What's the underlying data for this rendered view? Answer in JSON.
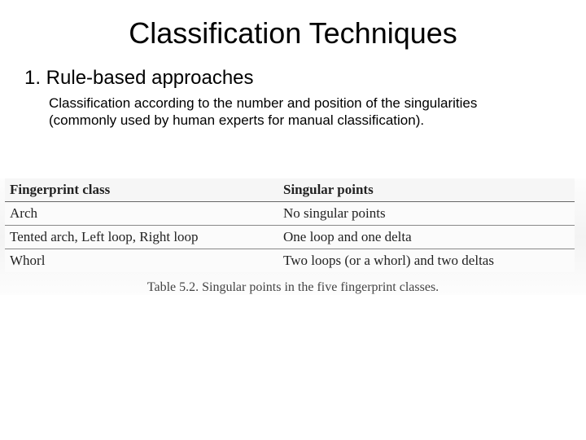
{
  "title": "Classification Techniques",
  "subheading": "1. Rule-based approaches",
  "body": "Classification according to the number and position of the singularities (commonly used by human experts for manual classification).",
  "table": {
    "headers": [
      "Fingerprint class",
      "Singular points"
    ],
    "rows": [
      [
        "Arch",
        "No singular points"
      ],
      [
        "Tented arch, Left loop, Right loop",
        "One loop and one delta"
      ],
      [
        "Whorl",
        "Two loops (or a whorl) and two deltas"
      ]
    ]
  },
  "caption": "Table 5.2. Singular points in the five fingerprint classes."
}
